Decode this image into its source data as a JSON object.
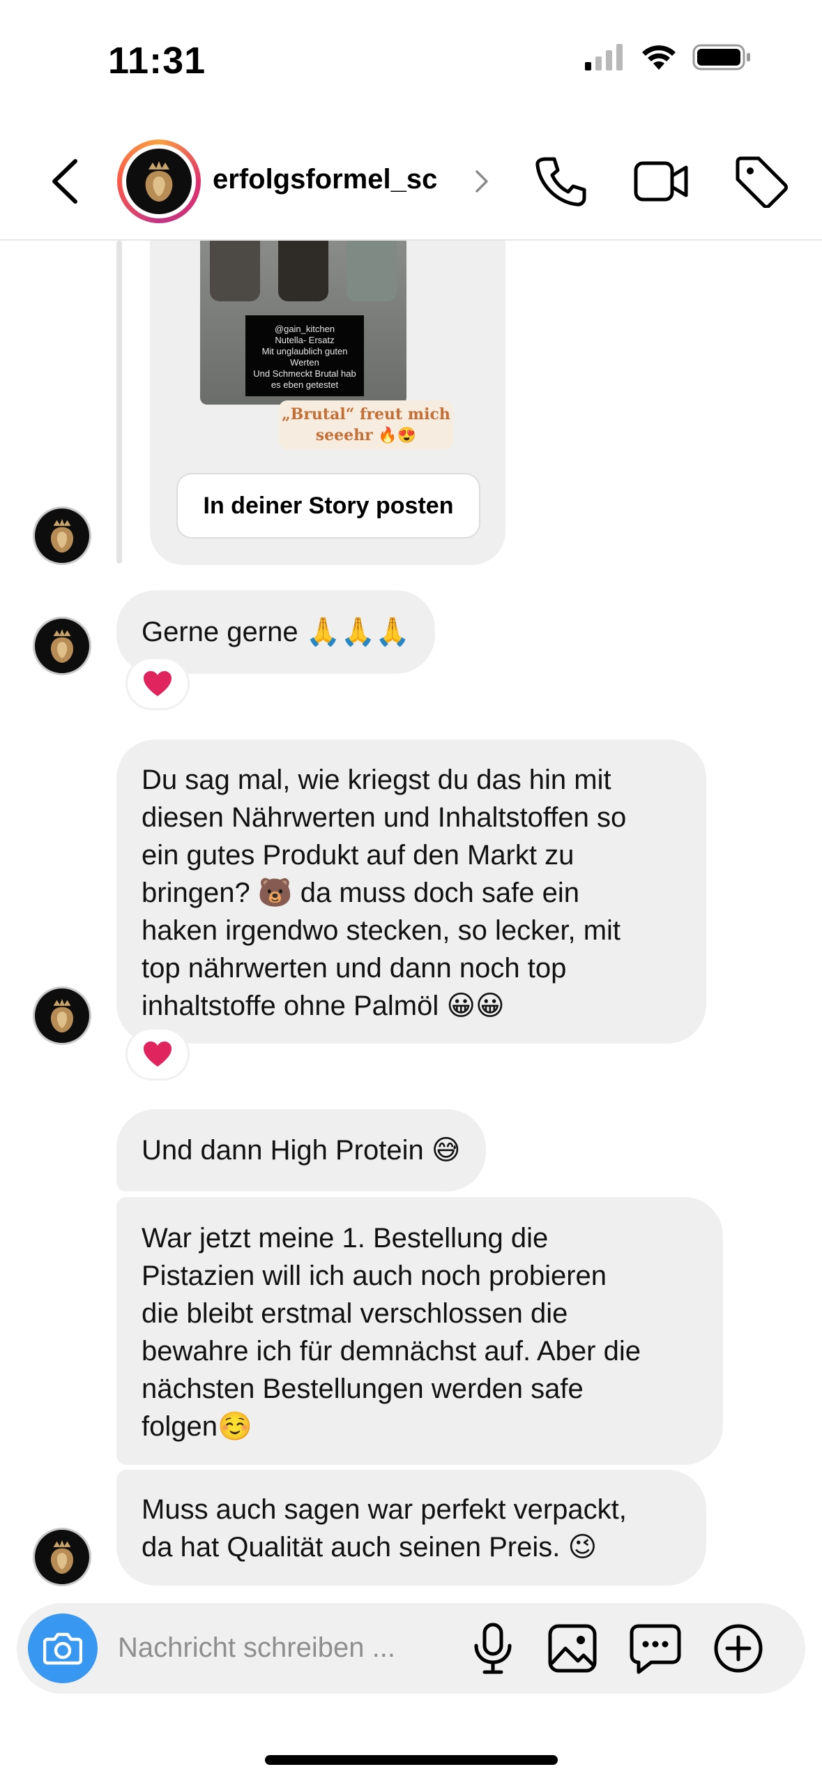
{
  "status_bar": {
    "time": "11:31",
    "icons": [
      "signal-icon",
      "wifi-icon",
      "battery-icon"
    ]
  },
  "header": {
    "username": "erfolgsformel_sc",
    "icons": [
      "back-icon",
      "chevron-right-icon",
      "phone-icon",
      "video-icon",
      "tag-icon"
    ]
  },
  "story": {
    "tag_lines": [
      "@gain_kitchen",
      "Nutella- Ersatz",
      "Mit unglaublich guten",
      "Werten",
      "Und Schmeckt Brutal hab",
      "es eben getestet"
    ],
    "sticker_lines": [
      "„Brutal“ freut mich",
      "seeehr 🔥😍"
    ],
    "button_label": "In deiner Story posten"
  },
  "messages": [
    {
      "lines": [
        "Gerne gerne 🙏🙏🙏"
      ],
      "reaction": "❤️"
    },
    {
      "lines": [
        "Du sag mal, wie kriegst du das hin mit",
        "diesen Nährwerten und Inhaltstoffen so",
        "ein gutes Produkt auf den Markt zu",
        "bringen? 🐻 da muss doch safe ein",
        "haken irgendwo stecken, so lecker, mit",
        "top nährwerten und dann noch top",
        "inhaltstoffe ohne Palmöl 😀😀"
      ],
      "reaction": "❤️"
    },
    {
      "lines": [
        "Und dann High Protein 😅"
      ]
    },
    {
      "lines": [
        "War jetzt meine 1. Bestellung die",
        "Pistazien will ich auch noch probieren",
        "die bleibt erstmal verschlossen die",
        "bewahre ich für demnächst auf. Aber die",
        "nächsten Bestellungen werden safe",
        "folgen☺️"
      ]
    },
    {
      "lines": [
        "Muss auch sagen war perfekt verpackt,",
        "da hat Qualität auch seinen Preis. 😉"
      ]
    }
  ],
  "composer": {
    "placeholder": "Nachricht schreiben ...",
    "icons": [
      "camera-icon",
      "microphone-icon",
      "gallery-icon",
      "sticker-chat-icon",
      "plus-icon"
    ]
  },
  "colors": {
    "accent": "#3897f0",
    "bubble": "#efefef",
    "reaction_heart": "#e0245e"
  }
}
